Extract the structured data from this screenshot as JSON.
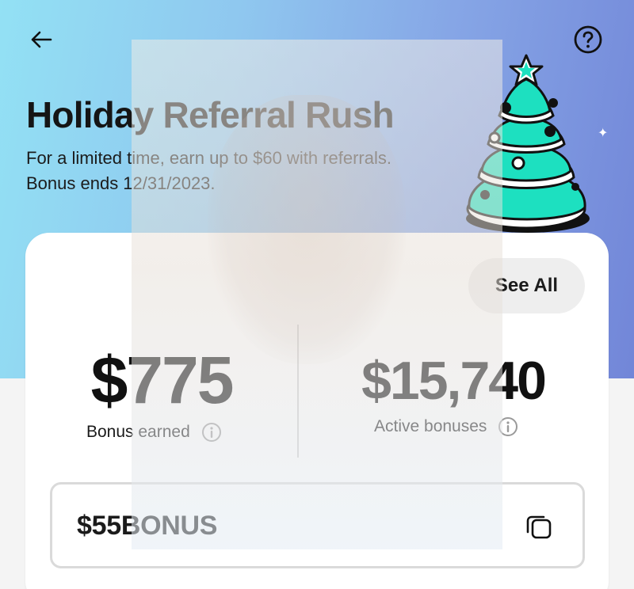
{
  "header": {
    "back_icon": "arrow-left-icon",
    "help_icon": "question-circle-icon",
    "title": "Holiday Referral Rush",
    "subtitle": "For a limited time, earn up to $60 with referrals. Bonus ends 12/31/2023."
  },
  "decoration": {
    "tree_icon": "christmas-tree-icon",
    "sparkle": "✦"
  },
  "summary": {
    "see_all_label": "See All",
    "bonus_earned_value": "$775",
    "bonus_earned_label": "Bonus earned",
    "active_bonuses_value": "$15,740",
    "active_bonuses_label": "Active bonuses",
    "info_icon": "info-circle-icon"
  },
  "referral_code": {
    "code": "$55BONUS",
    "copy_icon": "copy-icon"
  },
  "colors": {
    "gradient_start": "#93e1f4",
    "gradient_end": "#7286d8",
    "tree_mint": "#1de0c0",
    "card_bg": "#ffffff",
    "page_bg": "#f4f4f4"
  }
}
